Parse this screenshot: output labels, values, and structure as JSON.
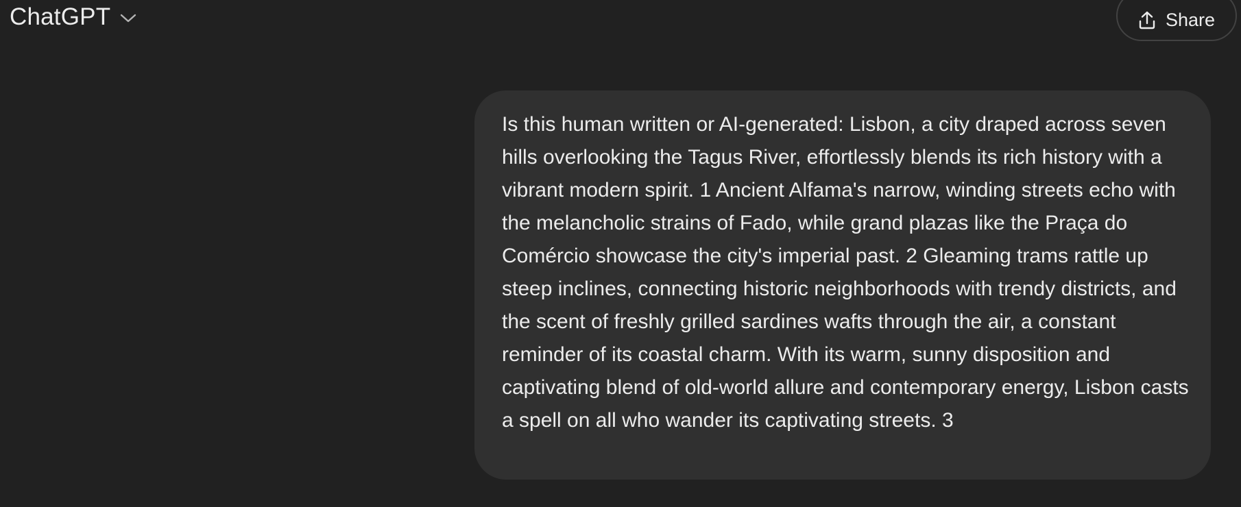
{
  "header": {
    "model_name": "ChatGPT",
    "model_chevron_icon": "chevron-down-icon",
    "share_label": "Share",
    "share_icon": "upload-icon"
  },
  "conversation": {
    "messages": [
      {
        "role": "user",
        "text": "Is this human written or AI-generated: Lisbon, a city draped across seven hills overlooking the Tagus River, effortlessly blends its rich history with a vibrant modern spirit. 1  Ancient Alfama's narrow, winding streets echo with the melancholic strains of Fado, while grand plazas like the Praça do Comércio showcase the city's imperial past. 2  Gleaming trams rattle up steep inclines, connecting historic neighborhoods with trendy districts, and the scent of freshly grilled sardines wafts through the air, a constant reminder of its coastal charm. With its warm, sunny disposition and captivating blend of old-world allure and contemporary energy, Lisbon casts a spell on all who wander its captivating streets. 3"
      }
    ]
  },
  "colors": {
    "background": "#212121",
    "bubble": "#303030",
    "text": "#ececec",
    "border": "#424242"
  }
}
